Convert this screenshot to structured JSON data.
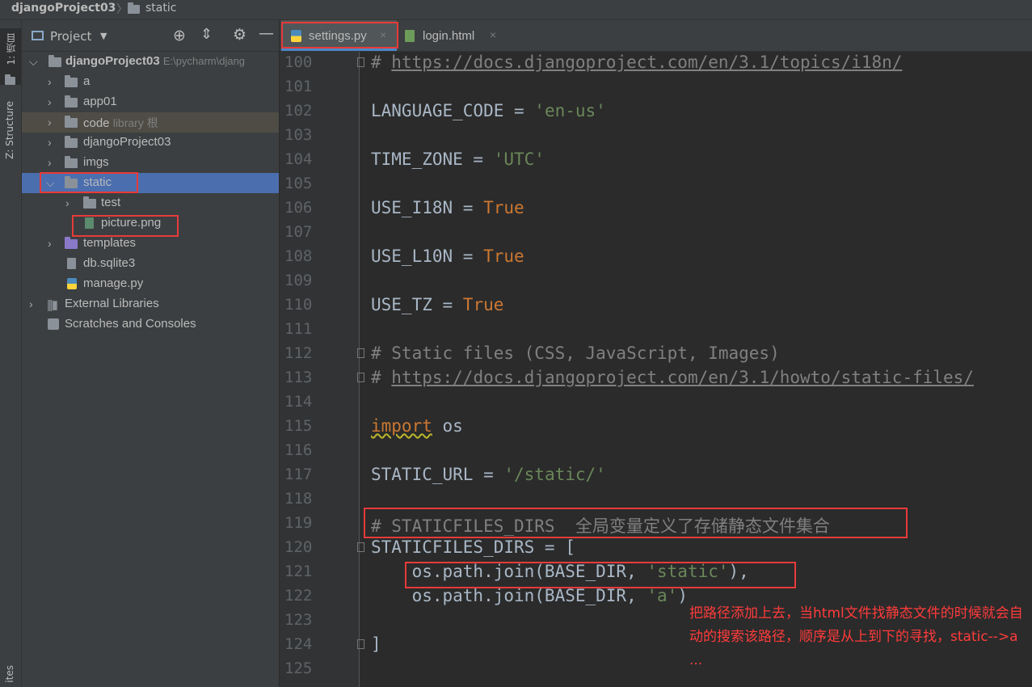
{
  "titlebar": {
    "project": "djangoProject03",
    "current": "static"
  },
  "leftstrip": {
    "tab1": "1: 项目",
    "tab2": "Z: Structure",
    "tab3": "ites"
  },
  "panel": {
    "title": "Project"
  },
  "tree": {
    "root_name": "djangoProject03",
    "root_path": "E:\\pycharm\\djang",
    "items": [
      {
        "label": "a"
      },
      {
        "label": "app01"
      },
      {
        "label": "code",
        "hint": "library 根"
      },
      {
        "label": "djangoProject03"
      },
      {
        "label": "imgs"
      },
      {
        "label": "static"
      },
      {
        "label": "test"
      },
      {
        "label": "picture.png"
      },
      {
        "label": "templates"
      },
      {
        "label": "db.sqlite3"
      },
      {
        "label": "manage.py"
      },
      {
        "label": "External Libraries"
      },
      {
        "label": "Scratches and Consoles"
      }
    ]
  },
  "tabs": [
    {
      "label": "settings.py"
    },
    {
      "label": "login.html"
    }
  ],
  "code": {
    "line_numbers": [
      "100",
      "101",
      "102",
      "103",
      "104",
      "105",
      "106",
      "107",
      "108",
      "109",
      "110",
      "111",
      "112",
      "113",
      "114",
      "115",
      "116",
      "117",
      "118",
      "119",
      "120",
      "121",
      "122",
      "123",
      "124",
      "125"
    ],
    "l100_hash": "# ",
    "l100_url": "https://docs.djangoproject.com/en/3.1/topics/i18n/",
    "l102_a": "LANGUAGE_CODE = ",
    "l102_b": "'en-us'",
    "l104_a": "TIME_ZONE = ",
    "l104_b": "'UTC'",
    "l106_a": "USE_I18N = ",
    "l106_b": "True",
    "l108_a": "USE_L10N = ",
    "l108_b": "True",
    "l110_a": "USE_TZ = ",
    "l110_b": "True",
    "l112": "# Static files (CSS, JavaScript, Images)",
    "l113_hash": "# ",
    "l113_url": "https://docs.djangoproject.com/en/3.1/howto/static-files/",
    "l115_a": "import",
    "l115_b": " os",
    "l117_a": "STATIC_URL = ",
    "l117_b": "'/static/'",
    "l119": "# STATICFILES_DIRS  全局变量定义了存储静态文件集合",
    "l120": "STATICFILES_DIRS = [",
    "l121_a": "    os.path.join(BASE_DIR, ",
    "l121_b": "'static'",
    "l121_c": "),",
    "l122_a": "    os.path.join(BASE_DIR, ",
    "l122_b": "'a'",
    "l122_c": ")",
    "l124": "]"
  },
  "annotation": {
    "text": "把路径添加上去，当html文件找静态文件的时候就会自动的搜索该路径，顺序是从上到下的寻找，static-->a  ..."
  },
  "colors": {
    "highlight_box": "#e83a3a",
    "selection": "#4b6eaf",
    "annotation": "#ff3b3b"
  }
}
